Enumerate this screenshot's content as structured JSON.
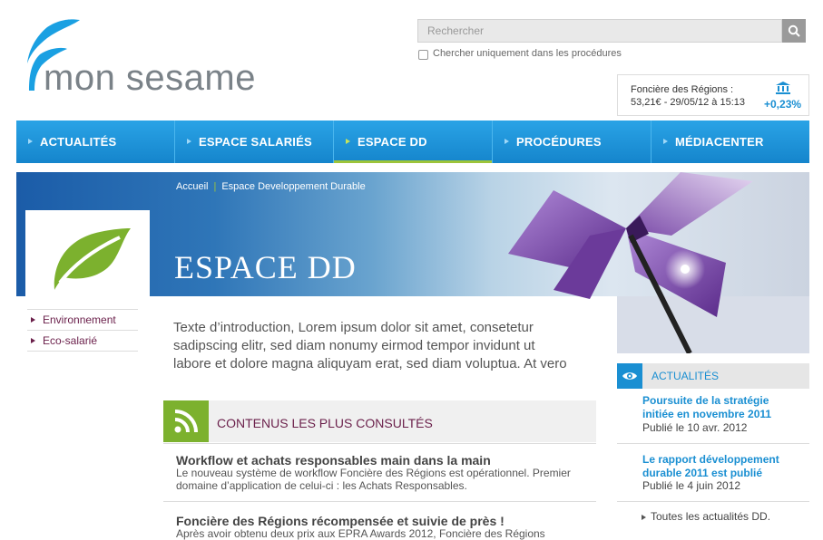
{
  "brand": {
    "name": "mon sesame"
  },
  "search": {
    "placeholder": "Rechercher",
    "checkbox_label": "Chercher uniquement dans les procédures"
  },
  "stock": {
    "name": "Foncière des Régions :",
    "value": "53,21€ - 29/05/12 à 15:13",
    "change": "+0,23%"
  },
  "nav": {
    "items": [
      {
        "label": "ACTUALITÉS"
      },
      {
        "label": "ESPACE SALARIÉS"
      },
      {
        "label": "ESPACE DD"
      },
      {
        "label": "PROCÉDURES"
      },
      {
        "label": "MÉDIACENTER"
      }
    ]
  },
  "breadcrumb": {
    "home": "Accueil",
    "current": "Espace Developpement Durable"
  },
  "page_title": "ESPACE DD",
  "sidebar": {
    "items": [
      {
        "label": "Environnement"
      },
      {
        "label": "Eco-salarié"
      }
    ]
  },
  "intro": "Texte d’introduction, Lorem ipsum dolor sit amet, consetetur sadipscing elitr, sed diam nonumy eirmod tempor invidunt ut labore et dolore magna aliquyam erat, sed diam voluptua. At vero",
  "most_consulted": {
    "title": "CONTENUS LES PLUS CONSULTÉS",
    "articles": [
      {
        "title": "Workflow et achats responsables main dans la main",
        "desc": "Le nouveau système de workflow Foncière des Régions est opérationnel. Premier domaine d’application de celui-ci : les Achats Responsables."
      },
      {
        "title": "Foncière des Régions récompensée et suivie de près !",
        "desc": "Après avoir obtenu deux prix aux EPRA Awards 2012, Foncière des Régions"
      }
    ]
  },
  "news": {
    "title": "ACTUALITÉS",
    "items": [
      {
        "title": "Poursuite de la stratégie initiée en novembre 2011",
        "date": "Publié le 10 avr. 2012"
      },
      {
        "title": "Le rapport développement durable 2011 est publié",
        "date": "Publié le 4 juin 2012"
      }
    ],
    "all_link": "Toutes les actualités DD."
  }
}
